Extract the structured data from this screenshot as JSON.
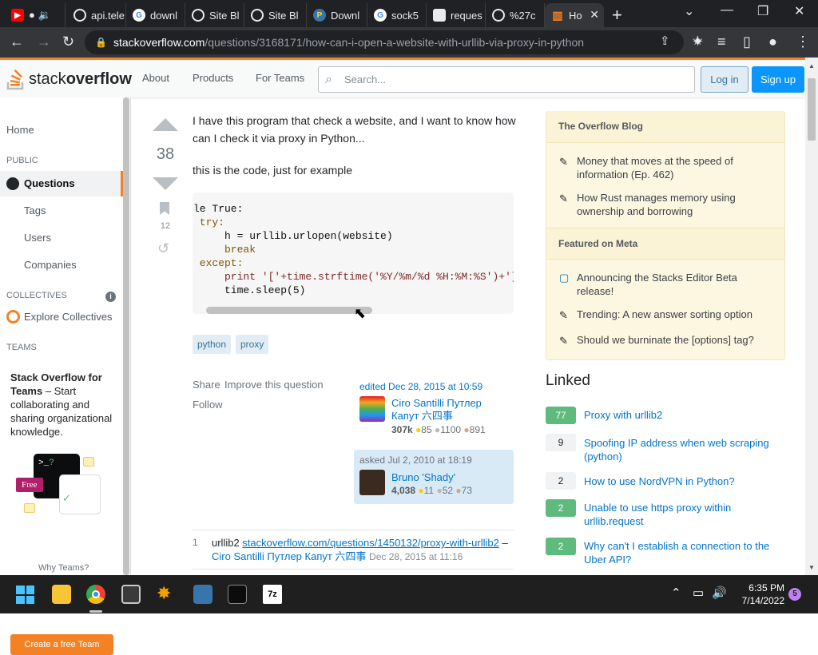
{
  "browser": {
    "tabs": [
      {
        "label": "● 🔉",
        "icon": "youtube-icon"
      },
      {
        "label": "api.tele",
        "icon": "globe-icon"
      },
      {
        "label": "downl",
        "icon": "google-icon"
      },
      {
        "label": "Site Bl",
        "icon": "globe-icon"
      },
      {
        "label": "Site Bl",
        "icon": "globe-icon"
      },
      {
        "label": "Downl",
        "icon": "python-icon"
      },
      {
        "label": "sock5",
        "icon": "google-icon"
      },
      {
        "label": "reques",
        "icon": "box-icon"
      },
      {
        "label": "%27c",
        "icon": "globe-icon"
      },
      {
        "label": "Ho",
        "icon": "stackoverflow-icon",
        "active": true
      }
    ],
    "url_host": "stackoverflow.com",
    "url_path": "/questions/3168171/how-can-i-open-a-website-with-urllib-via-proxy-in-python"
  },
  "header": {
    "logo_plain": "stack",
    "logo_bold": "overflow",
    "nav": [
      "About",
      "Products",
      "For Teams"
    ],
    "search_placeholder": "Search...",
    "login": "Log in",
    "signup": "Sign up"
  },
  "leftnav": {
    "home": "Home",
    "public": "PUBLIC",
    "questions": "Questions",
    "tags": "Tags",
    "users": "Users",
    "companies": "Companies",
    "collectives": "COLLECTIVES",
    "explore": "Explore Collectives",
    "teams": "TEAMS",
    "teams_title": "Stack Overflow for Teams",
    "teams_desc": " – Start collaborating and sharing organizational knowledge.",
    "free_badge": "Free",
    "create_team": "Create a free Team",
    "why_teams": "Why Teams?"
  },
  "question": {
    "votes": "38",
    "bookmarks": "12",
    "body1": "I have this program that check a website, and I want to know how can I check it via proxy in Python...",
    "body2": "this is the code, just for example",
    "code_lines": [
      "le True:",
      " try:",
      "     h = urllib.urlopen(website)",
      "     break",
      " except:",
      "     print '['+time.strftime('%Y/%m/%d %H:%M:%S')+']",
      "     time.sleep(5)"
    ],
    "tags": [
      "python",
      "proxy"
    ],
    "actions": {
      "share": "Share",
      "improve": "Improve this question",
      "follow": "Follow"
    },
    "edited": {
      "label": "edited Dec 28, 2015 at 10:59",
      "user": "Ciro Santilli Путлер Капут 六四事",
      "rep": "307k",
      "gold": "85",
      "silver": "1100",
      "bronze": "891"
    },
    "asked": {
      "label": "asked Jul 2, 2010 at 18:19",
      "user": "Bruno 'Shady'",
      "rep": "4,038",
      "gold": "11",
      "silver": "52",
      "bronze": "73"
    },
    "comment": {
      "score": "1",
      "text_prefix": "urllib2 ",
      "link": "stackoverflow.com/questions/1450132/proxy-with-urllib2",
      "dash": " – ",
      "user": "Ciro Santilli Путлер Капут 六四事",
      "date": "Dec 28, 2015 at 11:16"
    }
  },
  "sidebar": {
    "blog_title": "The Overflow Blog",
    "blog_items": [
      "Money that moves at the speed of information (Ep. 462)",
      "How Rust manages memory using ownership and borrowing"
    ],
    "meta_title": "Featured on Meta",
    "meta_items": [
      "Announcing the Stacks Editor Beta release!",
      "Trending: A new answer sorting option",
      "Should we burninate the [options] tag?"
    ],
    "linked_title": "Linked",
    "linked": [
      {
        "score": "77",
        "text": "Proxy with urllib2",
        "accepted": true
      },
      {
        "score": "9",
        "text": "Spoofing IP address when web scraping (python)",
        "accepted": false
      },
      {
        "score": "2",
        "text": "How to use NordVPN in Python?",
        "accepted": false
      },
      {
        "score": "2",
        "text": "Unable to use https proxy within urllib.request",
        "accepted": true
      },
      {
        "score": "2",
        "text": "Why can't I establish a connection to the Uber API?",
        "accepted": true
      }
    ]
  },
  "taskbar": {
    "time": "6:35 PM",
    "date": "7/14/2022",
    "notifications": "5"
  },
  "colors": {
    "accent": "#f48225",
    "link": "#0074cc",
    "accepted": "#5eba7d"
  }
}
